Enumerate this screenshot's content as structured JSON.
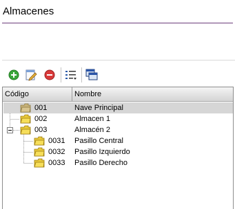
{
  "page": {
    "title": "Almacenes"
  },
  "toolbar": {
    "add_icon": "add-icon",
    "edit_icon": "edit-icon",
    "delete_icon": "delete-icon",
    "list_icon": "list-options-icon",
    "windows_icon": "windows-icon"
  },
  "grid": {
    "columns": [
      "Código",
      "Nombre"
    ],
    "rows": [
      {
        "code": "001",
        "name": "Nave Principal",
        "level": 0,
        "selected": true
      },
      {
        "code": "002",
        "name": "Almacen 1",
        "level": 0,
        "selected": false
      },
      {
        "code": "003",
        "name": "Almacén 2",
        "level": 0,
        "expanded": true,
        "selected": false
      },
      {
        "code": "0031",
        "name": "Pasillo Central",
        "level": 1,
        "selected": false
      },
      {
        "code": "0032",
        "name": "Pasillo Izquierdo",
        "level": 1,
        "selected": false
      },
      {
        "code": "0033",
        "name": "Pasillo Derecho",
        "level": 1,
        "selected": false
      }
    ]
  },
  "colors": {
    "title_rule": "#6b3a7a",
    "selected_row": "#d6d6d6",
    "folder": "#f2d13a"
  }
}
